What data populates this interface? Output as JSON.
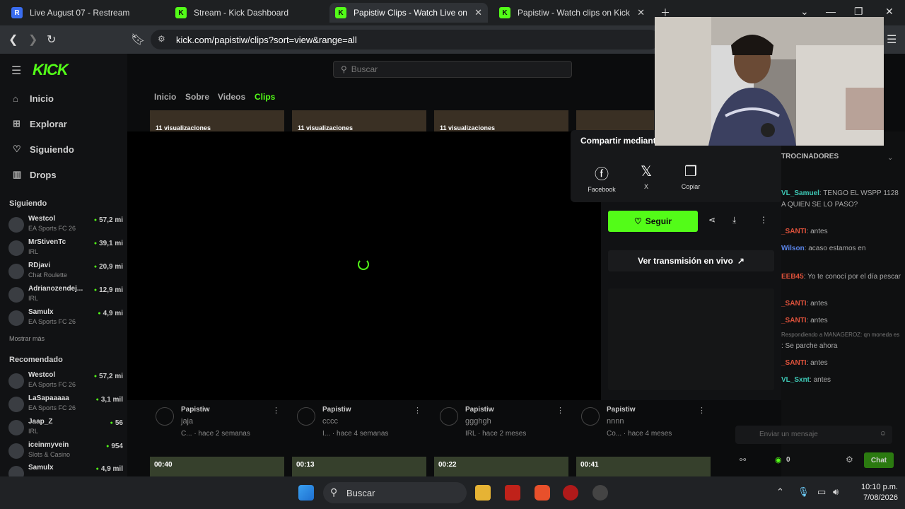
{
  "browser": {
    "tabs": [
      {
        "title": "Live August 07 - Restream",
        "favicon": "R",
        "favicon_color": "#3a6df0"
      },
      {
        "title": "Stream - Kick Dashboard",
        "favicon": "K",
        "favicon_color": "#53fc18"
      },
      {
        "title": "Papistiw Clips - Watch Live on Kick",
        "favicon": "K",
        "favicon_color": "#53fc18",
        "active": true
      },
      {
        "title": "Papistiw - Watch clips on Kick",
        "favicon": "K",
        "favicon_color": "#53fc18"
      }
    ],
    "url": "kick.com/papistiw/clips?sort=view&range=all"
  },
  "site": {
    "logo": "KICK",
    "search_placeholder": "Buscar",
    "nav": [
      {
        "label": "Inicio",
        "icon": "home-icon"
      },
      {
        "label": "Explorar",
        "icon": "compass-icon"
      },
      {
        "label": "Siguiendo",
        "icon": "heart-icon"
      },
      {
        "label": "Drops",
        "icon": "gift-icon"
      }
    ],
    "following_title": "Siguiendo",
    "following": [
      {
        "name": "Westcol",
        "category": "EA Sports FC 26",
        "viewers": "57,2 mi"
      },
      {
        "name": "MrStivenTc",
        "category": "IRL",
        "viewers": "39,1 mi"
      },
      {
        "name": "RDjavi",
        "category": "Chat Roulette",
        "viewers": "20,9 mi"
      },
      {
        "name": "Adrianozendej...",
        "category": "IRL",
        "viewers": "12,9 mi"
      },
      {
        "name": "Samulx",
        "category": "EA Sports FC 26",
        "viewers": "4,9 mi"
      }
    ],
    "show_more": "Mostrar más",
    "recommended_title": "Recomendado",
    "recommended": [
      {
        "name": "Westcol",
        "category": "EA Sports FC 26",
        "viewers": "57,2 mi"
      },
      {
        "name": "LaSapaaaaa",
        "category": "EA Sports FC 26",
        "viewers": "3,1 mil"
      },
      {
        "name": "Jaap_Z",
        "category": "IRL",
        "viewers": "56"
      },
      {
        "name": "iceinmyvein",
        "category": "Slots & Casino",
        "viewers": "954"
      },
      {
        "name": "Samulx",
        "category": "",
        "viewers": "4,9 mil"
      }
    ]
  },
  "profile_tabs": [
    "Inicio",
    "Sobre",
    "Videos",
    "Clips"
  ],
  "clip_thumbs_top": [
    "11 visualizaciones",
    "11 visualizaciones",
    "11 visualizaciones",
    ""
  ],
  "clip_cards": [
    {
      "author": "Papistiw",
      "title": "jaja",
      "tag": "C...",
      "age": "hace 2 semanas"
    },
    {
      "author": "Papistiw",
      "title": "cccc",
      "tag": "I...",
      "age": "hace 4 semanas"
    },
    {
      "author": "Papistiw",
      "title": "ggghgh",
      "tag": "IRL",
      "age": "hace 2 meses"
    },
    {
      "author": "Papistiw",
      "title": "nnnn",
      "tag": "Co...",
      "age": "hace 4 meses"
    }
  ],
  "clip_durations_bottom": [
    "00:40",
    "00:13",
    "00:22",
    "00:41"
  ],
  "share": {
    "title": "Compartir mediante",
    "options": [
      {
        "label": "Facebook",
        "icon": "facebook-icon"
      },
      {
        "label": "X",
        "icon": "x-icon"
      },
      {
        "label": "Copiar",
        "icon": "copy-icon"
      }
    ]
  },
  "clip_panel": {
    "follow": "Seguir",
    "watch_live": "Ver transmisión en vivo"
  },
  "chat": {
    "header": "TROCINADORES",
    "messages": [
      {
        "user": "VL_Samuel",
        "text": ": TENGO EL WSPP 1128 A QUIEN SE LO PASO?",
        "color": "#3ec9b6"
      },
      {
        "user": "_SANTI",
        "text": ": antes",
        "color": "#e0523b"
      },
      {
        "user": "Wilson",
        "text": ": acaso estamos en",
        "color": "#5a84e8"
      },
      {
        "user": "EEB45",
        "text": ": Yo te conocí por el día pescar",
        "color": "#e0523b"
      },
      {
        "user": "_SANTI",
        "text": ": antes",
        "color": "#e0523b"
      },
      {
        "user": "_SANTI",
        "text": ": antes",
        "color": "#e0523b"
      },
      {
        "user": "",
        "text": "Respondiendo a MANAGEROZ: qn moneda es",
        "color": "#888"
      },
      {
        "user": "",
        "text": ": Se parche ahora",
        "color": "#bbb"
      },
      {
        "user": "_SANTI",
        "text": ": antes",
        "color": "#e0523b"
      },
      {
        "user": "VL_Sxnt",
        "text": ": antes",
        "color": "#3ec9b6"
      }
    ],
    "input_placeholder": "Enviar un mensaje",
    "points": "0",
    "send": "Chat"
  },
  "taskbar": {
    "search": "Buscar",
    "time": "10:10 p.m.",
    "date": "7/08/2026"
  }
}
